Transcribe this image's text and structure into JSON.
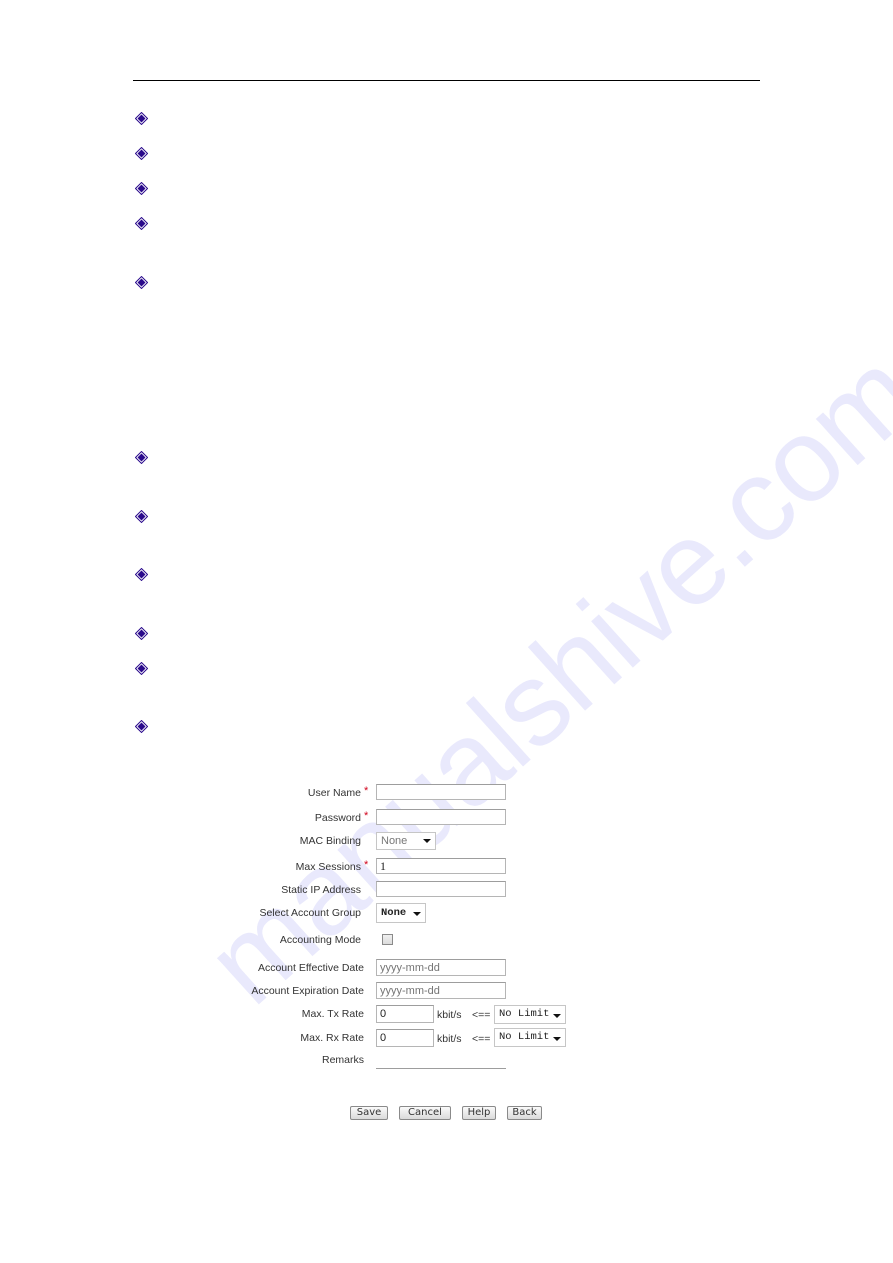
{
  "document": {
    "bullet_icon": "diamond-bullet",
    "bullet_color": "#2a0a8c",
    "bullet_count": 11,
    "watermark": "manualshive.com"
  },
  "form": {
    "required_marker": "*",
    "fields": {
      "user_name": {
        "label": "User Name",
        "value": "",
        "required": true
      },
      "password": {
        "label": "Password",
        "value": "",
        "required": true
      },
      "mac_binding": {
        "label": "MAC Binding",
        "selected": "None"
      },
      "max_sessions": {
        "label": "Max Sessions",
        "value": "1",
        "required": true
      },
      "static_ip": {
        "label": "Static IP Address",
        "value": ""
      },
      "account_group": {
        "label": "Select Account Group",
        "selected": "None"
      },
      "accounting_mode": {
        "label": "Accounting Mode",
        "checked": false
      },
      "effective_date": {
        "label": "Account Effective Date",
        "placeholder": "yyyy-mm-dd"
      },
      "expiration_date": {
        "label": "Account Expiration Date",
        "placeholder": "yyyy-mm-dd"
      },
      "tx_rate": {
        "label": "Max. Tx Rate",
        "value": "0",
        "unit": "kbit/s",
        "arrow": "<==",
        "preset": "No Limit"
      },
      "rx_rate": {
        "label": "Max. Rx Rate",
        "value": "0",
        "unit": "kbit/s",
        "arrow": "<==",
        "preset": "No Limit"
      },
      "remarks": {
        "label": "Remarks",
        "value": ""
      }
    },
    "buttons": {
      "save": "Save",
      "cancel": "Cancel",
      "help": "Help",
      "back": "Back"
    }
  }
}
